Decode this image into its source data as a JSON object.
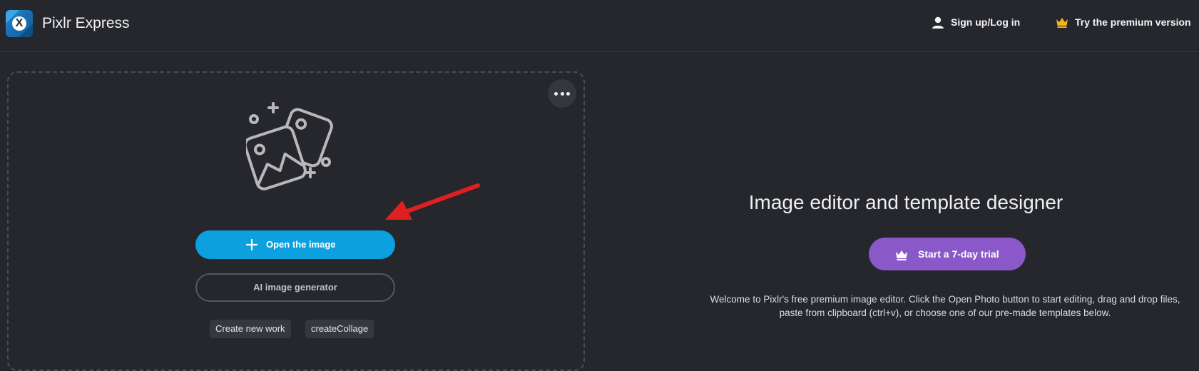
{
  "header": {
    "brand": "Pixlr Express",
    "logo_letter": "X",
    "signup_label": "Sign up/Log in",
    "premium_label": "Try the premium version",
    "icons": {
      "signup": "user-icon",
      "premium": "crown-icon"
    }
  },
  "left_panel": {
    "more_icon": "more-options-icon",
    "illustration": "images-illustration",
    "open_label": "Open the image",
    "ai_label": "AI image generator",
    "chips": [
      "Create new work",
      "createCollage"
    ]
  },
  "right_panel": {
    "title": "Image editor and template designer",
    "trial_label": "Start a 7-day trial",
    "welcome_text": "Welcome to Pixlr's free premium image editor. Click the Open Photo button to start editing, drag and drop files, paste from clipboard (ctrl+v), or choose one of our pre-made templates below."
  },
  "colors": {
    "background": "#25272c",
    "primary_blue": "#0ca0de",
    "trial_purple": "#8a58c9",
    "crown_gold": "#f3b51b",
    "annotation_arrow": "#e02020"
  }
}
